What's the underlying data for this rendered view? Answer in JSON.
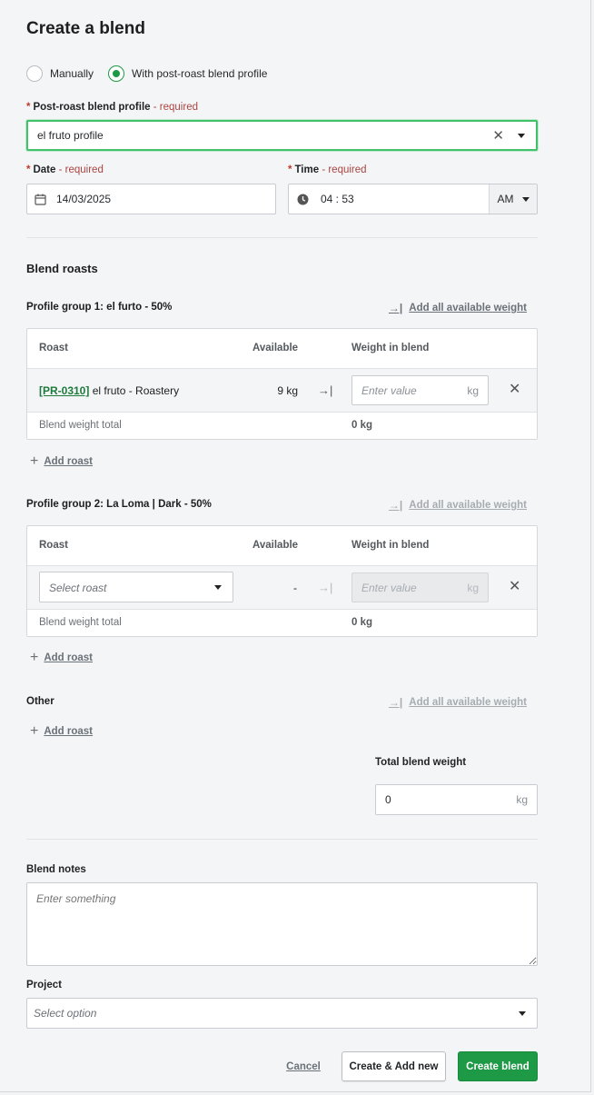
{
  "title": "Create a blend",
  "mode": {
    "manual_label": "Manually",
    "profile_label": "With post-roast blend profile"
  },
  "profile": {
    "label": "Post-roast blend profile",
    "required": "- required",
    "value": "el fruto profile"
  },
  "date": {
    "label": "Date",
    "required": "- required",
    "value": "14/03/2025"
  },
  "time": {
    "label": "Time",
    "required": "- required",
    "value": "04 : 53",
    "ampm": "AM"
  },
  "blend_roasts": {
    "title": "Blend roasts",
    "add_all_label": "Add all available weight",
    "add_roast_label": "Add roast",
    "columns": {
      "roast": "Roast",
      "available": "Available",
      "weight": "Weight in blend"
    },
    "weight_placeholder": "Enter value",
    "unit": "kg",
    "total_label": "Blend weight total",
    "groups": [
      {
        "title": "Profile group 1: el furto - 50%",
        "row": {
          "code": "[PR-0310]",
          "name": "el fruto - Roastery",
          "available": "9 kg"
        },
        "total": "0 kg"
      },
      {
        "title": "Profile group 2: La Loma | Dark - 50%",
        "row": {
          "select_placeholder": "Select roast",
          "available": "-"
        },
        "total": "0 kg"
      }
    ],
    "other": {
      "title": "Other"
    }
  },
  "total_blend_weight": {
    "label": "Total blend weight",
    "value": "0",
    "unit": "kg"
  },
  "notes": {
    "label": "Blend notes",
    "placeholder": "Enter something"
  },
  "project": {
    "label": "Project",
    "placeholder": "Select option"
  },
  "footer": {
    "cancel": "Cancel",
    "create_add_new": "Create & Add new",
    "create": "Create blend"
  },
  "colors": {
    "primary": "#1e9a47",
    "focus_border": "#43c16a",
    "required": "#a94442",
    "link": "#1e7a3c"
  }
}
